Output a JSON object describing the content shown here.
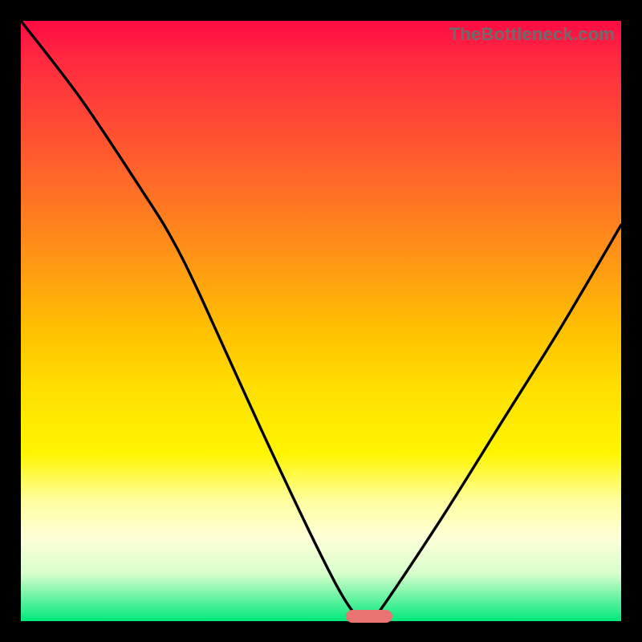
{
  "watermark": "TheBottleneck.com",
  "colors": {
    "frame": "#000000",
    "marker": "#e77471",
    "curve": "#000000"
  },
  "chart_data": {
    "type": "line",
    "title": "",
    "xlabel": "",
    "ylabel": "",
    "xlim": [
      0,
      100
    ],
    "ylim": [
      0,
      100
    ],
    "grid": false,
    "x": [
      0,
      10,
      20,
      25,
      30,
      40,
      50,
      55,
      58,
      60,
      70,
      80,
      90,
      100
    ],
    "values": [
      100,
      87,
      72,
      64,
      54,
      32,
      11,
      2,
      0,
      2,
      17,
      33,
      49,
      66
    ],
    "valley_x": 58,
    "annotations": [
      {
        "label": "optimal-marker",
        "x": 58,
        "y": 0,
        "color": "#e77471"
      }
    ]
  }
}
